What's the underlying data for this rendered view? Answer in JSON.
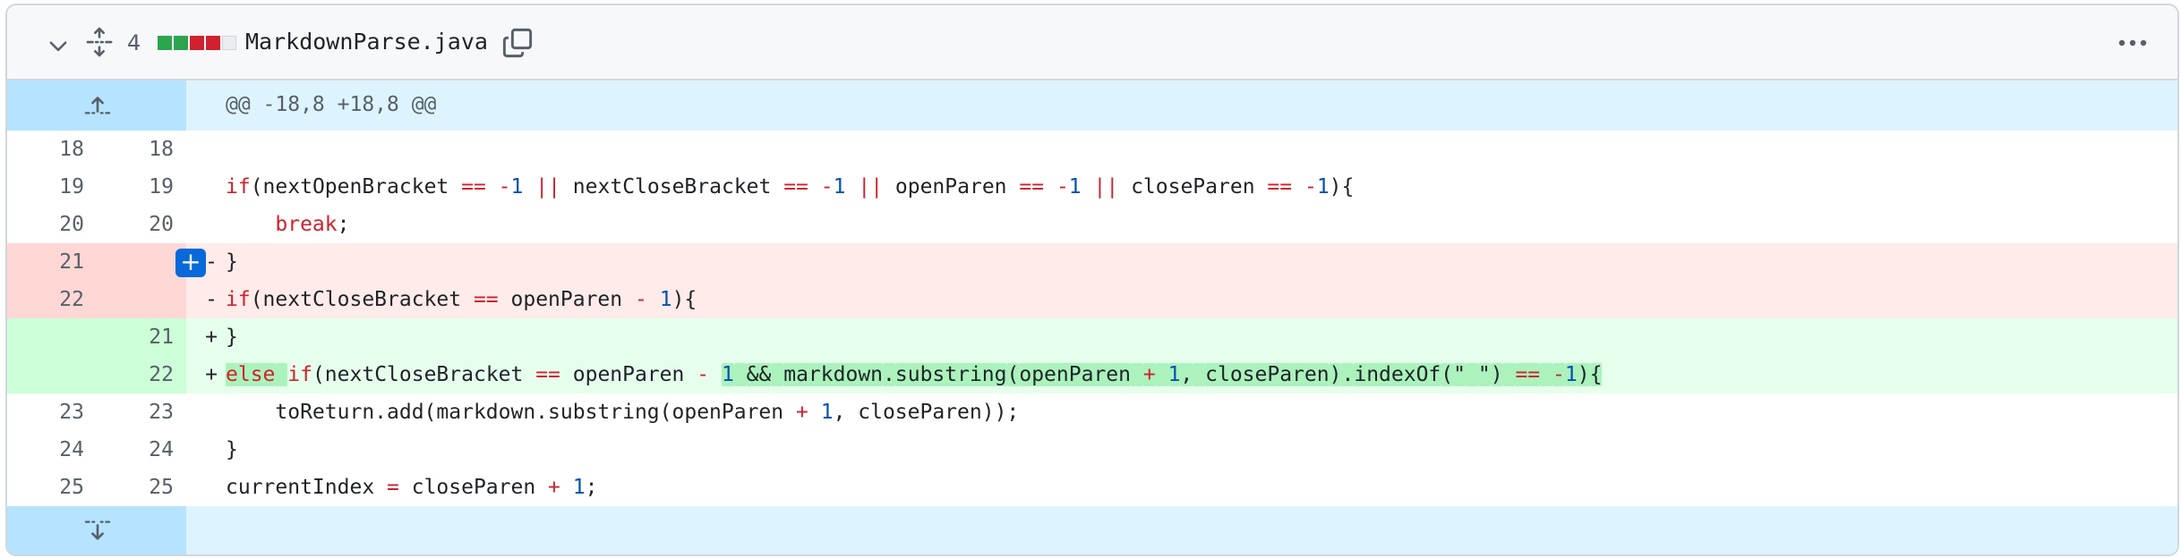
{
  "file": {
    "changed_lines": "4",
    "diffstat": [
      {
        "color": "#2da44e"
      },
      {
        "color": "#2da44e"
      },
      {
        "color": "#cf222e"
      },
      {
        "color": "#cf222e"
      },
      {
        "color": "#eaeef2"
      }
    ],
    "filename": "MarkdownParse.java",
    "icons": [
      "chevron-down-icon",
      "unfold-icon",
      "copy-icon",
      "kebab-horizontal-icon"
    ]
  },
  "hunk": {
    "header": "@@ -18,8 +18,8 @@"
  },
  "lines": [
    {
      "old": "18",
      "new": "18",
      "marker": "",
      "text": ""
    },
    {
      "old": "19",
      "new": "19",
      "marker": "",
      "text": "if(nextOpenBracket == -1 || nextCloseBracket == -1 || openParen == -1 || closeParen == -1){"
    },
    {
      "old": "20",
      "new": "20",
      "marker": "",
      "text": "    break;"
    },
    {
      "old": "21",
      "new": "",
      "marker": "-",
      "text": "}"
    },
    {
      "old": "22",
      "new": "",
      "marker": "-",
      "text": "if(nextCloseBracket == openParen - 1){"
    },
    {
      "old": "",
      "new": "21",
      "marker": "+",
      "text": "}"
    },
    {
      "old": "",
      "new": "22",
      "marker": "+",
      "text": "else if(nextCloseBracket == openParen - 1 && markdown.substring(openParen + 1, closeParen).indexOf(\" \") == -1){"
    },
    {
      "old": "23",
      "new": "23",
      "marker": "",
      "text": "    toReturn.add(markdown.substring(openParen + 1, closeParen));"
    },
    {
      "old": "24",
      "new": "24",
      "marker": "",
      "text": "}"
    },
    {
      "old": "25",
      "new": "25",
      "marker": "",
      "text": "currentIndex = closeParen + 1;"
    }
  ],
  "add_comment_label": "+",
  "colors": {
    "deletion_bg": "#ffebe9",
    "addition_bg": "#e6ffec",
    "hunk_bg": "#ddf4ff",
    "keyword": "#cf222e",
    "number": "#0550ae",
    "accent": "#0969da"
  }
}
